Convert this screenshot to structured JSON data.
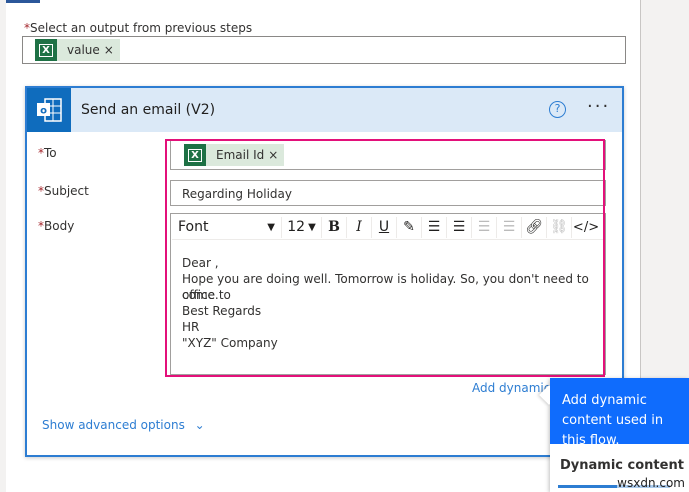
{
  "output_label": "Select an output from previous steps",
  "output_token": "value",
  "card": {
    "title": "Send an email (V2)",
    "help": "?",
    "more": "···"
  },
  "fields": {
    "to_label": "To",
    "to_token": "Email Id",
    "subject_label": "Subject",
    "subject_value": "Regarding Holiday",
    "body_label": "Body"
  },
  "toolbar": {
    "font": "Font",
    "size": "12",
    "bold": "B",
    "italic": "I",
    "underline": "U",
    "code": "</>"
  },
  "body_lines": [
    "Dear ,",
    "Hope you are doing well. Tomorrow is holiday. So, you don't need to come to",
    "office.",
    "Best Regards",
    "HR",
    "\"XYZ\" Company"
  ],
  "add_dynamic": "Add dynamic",
  "show_advanced": "Show advanced options",
  "popup": {
    "text": "Add dynamic content used in this flow.",
    "tab": "Dynamic content"
  },
  "watermark": "wsxdn.com",
  "remove": "×",
  "req": "*"
}
